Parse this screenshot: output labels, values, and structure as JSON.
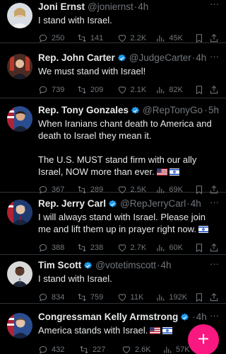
{
  "tweets": [
    {
      "name": "Joni Ernst",
      "verified": false,
      "handle": "@joniernst",
      "time": "4h",
      "text": "I stand with Israel.",
      "flags": [],
      "replies": "250",
      "retweets": "141",
      "likes": "2.2K",
      "views": "45K",
      "avatar_color": "#cfd8df"
    },
    {
      "name": "Rep. John Carter",
      "verified": true,
      "handle": "@JudgeCarter",
      "time": "4h",
      "text": "We must stand with Israel!",
      "flags": [],
      "replies": "739",
      "retweets": "209",
      "likes": "2.1K",
      "views": "82K",
      "avatar_color": "#3a2a22"
    },
    {
      "name": "Rep. Tony Gonzales",
      "verified": true,
      "handle": "@RepTonyGo...",
      "time": "5h",
      "text": "When Iranians chant death to America and death to Israel they mean it.\n\nThe U.S. MUST stand firm with our ally Israel, NOW more than ever.",
      "flags": [
        "us-flag-icon",
        "israel-flag-icon"
      ],
      "replies": "367",
      "retweets": "289",
      "likes": "2.5K",
      "views": "69K",
      "avatar_color": "#2a4d8f"
    },
    {
      "name": "Rep. Jerry Carl",
      "verified": true,
      "handle": "@RepJerryCarl",
      "time": "4h",
      "text": "I will always stand with Israel. Please join me and lift them up in prayer right now.",
      "flags": [
        "israel-flag-icon"
      ],
      "replies": "388",
      "retweets": "238",
      "likes": "2.7K",
      "views": "60K",
      "avatar_color": "#1f3a6e"
    },
    {
      "name": "Tim Scott",
      "verified": true,
      "handle": "@votetimscott",
      "time": "4h",
      "text": "I stand with Israel.",
      "flags": [],
      "replies": "834",
      "retweets": "759",
      "likes": "11K",
      "views": "192K",
      "avatar_color": "#d9d9d9"
    },
    {
      "name": "Congressman Kelly Armstrong",
      "verified": true,
      "handle": "",
      "time": "4h",
      "text": "America stands with Israel.",
      "flags": [
        "us-flag-icon",
        "israel-flag-icon"
      ],
      "replies": "432",
      "retweets": "227",
      "likes": "2.6K",
      "views": "57K",
      "avatar_color": "#2a4d8f"
    }
  ],
  "compose": {
    "label": "+"
  },
  "colors": {
    "background": "#000000",
    "text": "#e7e9ea",
    "muted": "#71767b",
    "verified": "#1d9bf0",
    "accent_pink": "#f91880",
    "divider": "#2f3336"
  },
  "separator": "·",
  "more_glyph": "···"
}
